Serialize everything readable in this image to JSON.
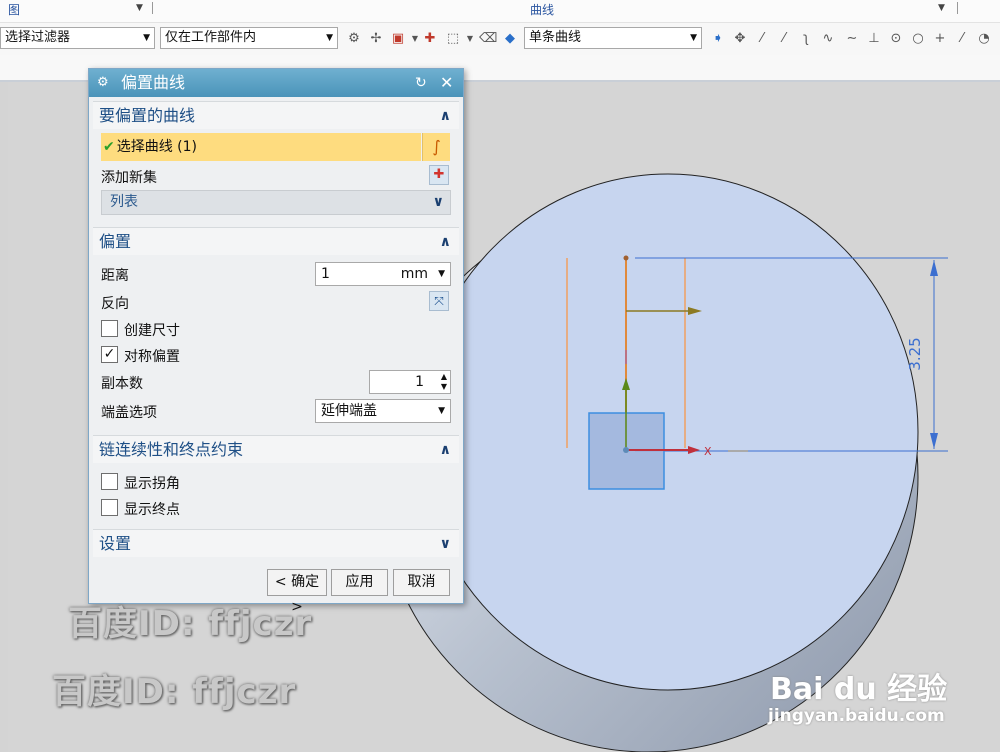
{
  "topbar": {
    "left_label": "图",
    "center_label": "曲线"
  },
  "filters": {
    "type_filter": "选择过滤器",
    "scope_filter": "仅在工作部件内",
    "curve_rule": "单条曲线"
  },
  "dialog": {
    "title": "偏置曲线",
    "sections": {
      "curve": {
        "title": "要偏置的曲线",
        "select_label": "选择曲线 (1)",
        "add_set_label": "添加新集",
        "list_label": "列表"
      },
      "offset": {
        "title": "偏置",
        "distance_label": "距离",
        "distance_value": "1",
        "distance_unit": "mm",
        "reverse_label": "反向",
        "create_dim_label": "创建尺寸",
        "create_dim_checked": false,
        "symmetric_label": "对称偏置",
        "symmetric_checked": true,
        "copies_label": "副本数",
        "copies_value": "1",
        "cap_label": "端盖选项",
        "cap_value": "延伸端盖"
      },
      "chain": {
        "title": "链连续性和终点约束",
        "show_corner_label": "显示拐角",
        "show_corner_checked": false,
        "show_end_label": "显示终点",
        "show_end_checked": false
      },
      "settings": {
        "title": "设置"
      }
    },
    "buttons": {
      "ok": "< 确定 >",
      "apply": "应用",
      "cancel": "取消"
    }
  },
  "graphics": {
    "dimension_text": "3.25",
    "axis_label": "X"
  },
  "watermark": {
    "line1": "百度ID: ffjczr",
    "line2": "百度ID: ffjczr",
    "brand": "Bai du 经验",
    "url": "jingyan.baidu.com"
  },
  "colors": {
    "accent": "#4a93b9",
    "selection": "#fedc7f",
    "section_title": "#1e4f86",
    "disk_face": "#c7d5ef",
    "curve": "#f0a060",
    "dimension": "#3c6fd0"
  }
}
